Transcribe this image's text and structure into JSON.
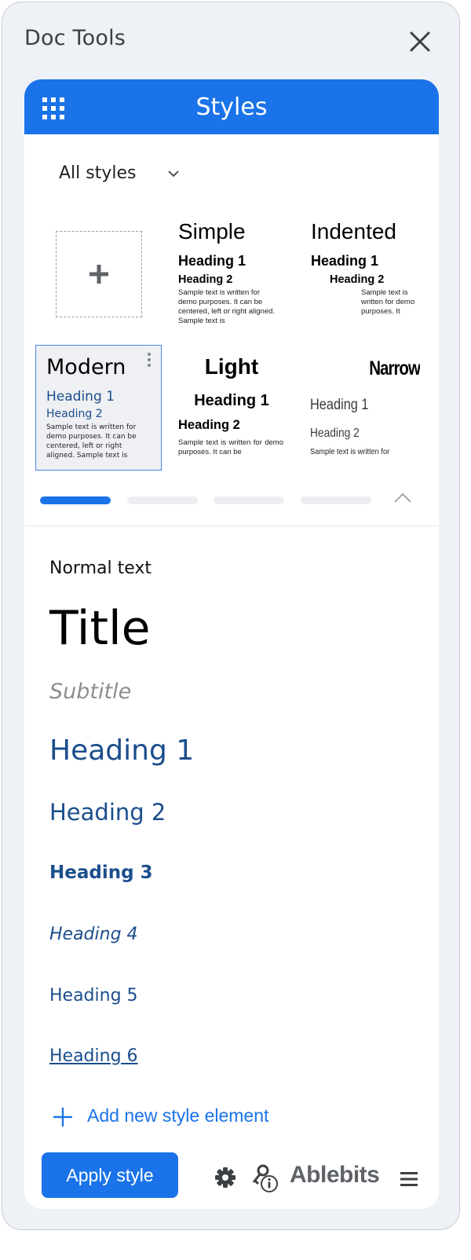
{
  "panel": {
    "title": "Doc Tools"
  },
  "header": {
    "title": "Styles"
  },
  "filter": {
    "label": "All styles"
  },
  "presets": [
    {
      "name": "Simple",
      "h1": "Heading 1",
      "h2": "Heading 2",
      "sample": "Sample text is written for demo purposes. It can be centered, left or right aligned. Sample text is"
    },
    {
      "name": "Indented",
      "h1": "Heading 1",
      "h2": "Heading 2",
      "sample": "Sample text is written for demo purposes. It"
    },
    {
      "name": "Modern",
      "h1": "Heading 1",
      "h2": "Heading 2",
      "sample": "Sample text is written for demo purposes. It can be centered, left or right aligned. Sample text is",
      "selected": true
    },
    {
      "name": "Light",
      "h1": "Heading 1",
      "h2": "Heading 2",
      "sample": "Sample text is written for demo purposes. It can be"
    },
    {
      "name": "Narrow",
      "h1": "Heading 1",
      "h2": "Heading 2",
      "sample": "Sample text is written for"
    }
  ],
  "pager": {
    "pages": 4,
    "active": 1
  },
  "style_elements": {
    "normal": "Normal text",
    "title": "Title",
    "subtitle": "Subtitle",
    "h1": "Heading 1",
    "h2": "Heading 2",
    "h3": "Heading 3",
    "h4": "Heading 4",
    "h5": "Heading 5",
    "h6": "Heading 6"
  },
  "add_element_label": "Add new style element",
  "footer": {
    "apply_label": "Apply style",
    "brand": "Ablebits"
  },
  "colors": {
    "accent": "#1a73e8",
    "heading": "#1b4e8c",
    "subtitle": "#8e8e8e"
  },
  "icons": [
    "close-icon",
    "apps-grid-icon",
    "chevron-down-icon",
    "plus-icon",
    "more-vert-icon",
    "chevron-up-icon",
    "gear-icon",
    "key-info-icon",
    "menu-icon"
  ]
}
